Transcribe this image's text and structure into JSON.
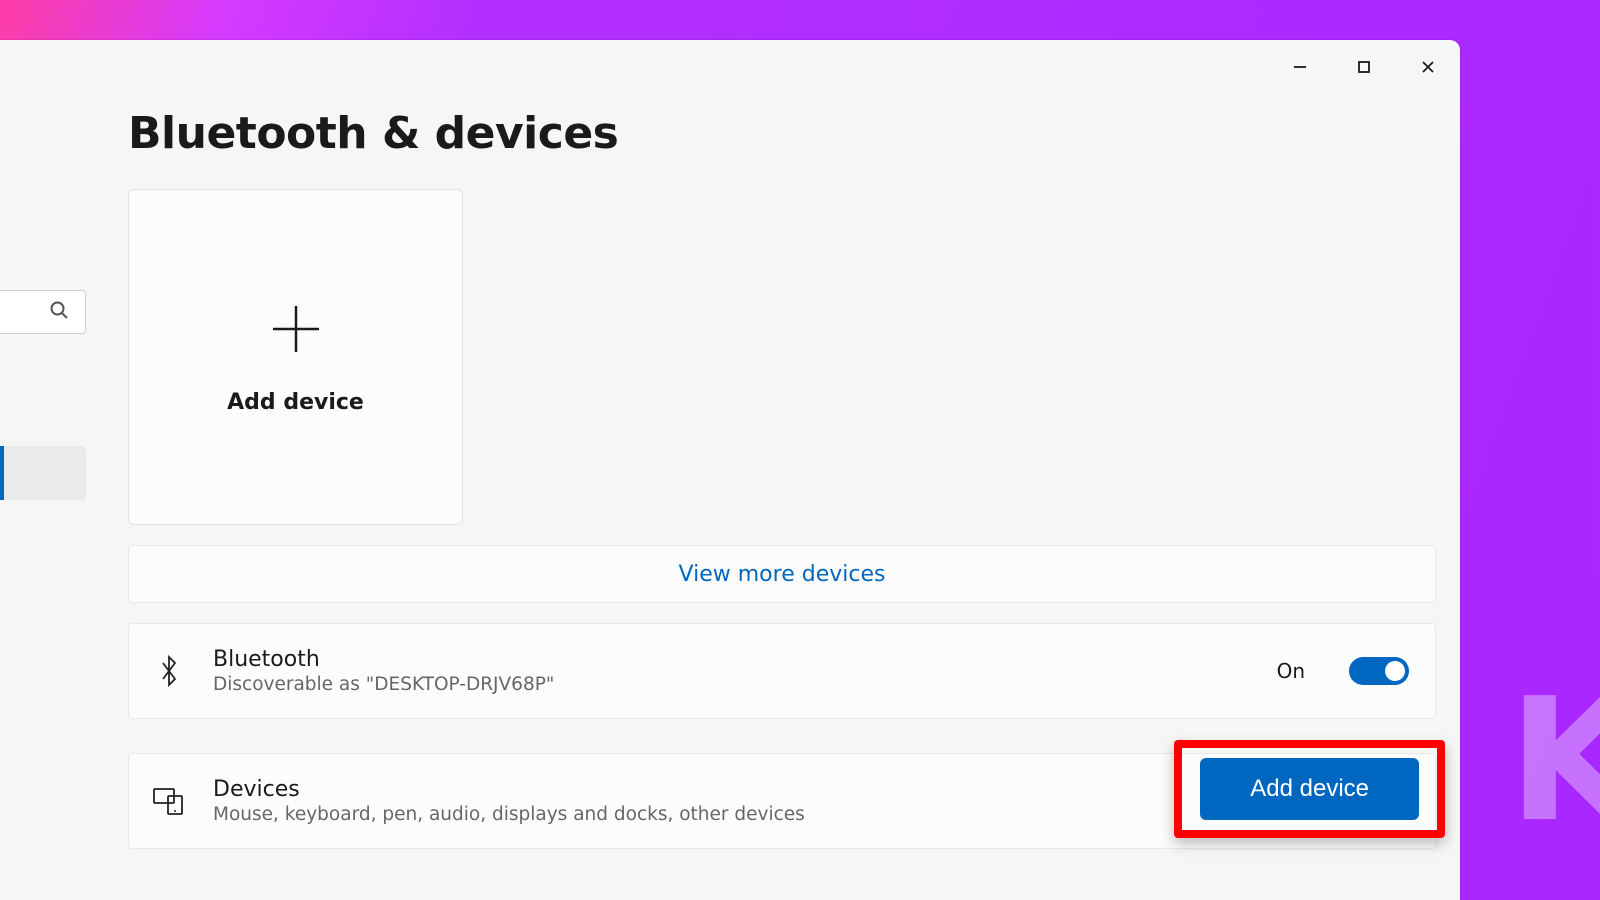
{
  "header": {
    "title": "Bluetooth & devices"
  },
  "add_device_card": {
    "label": "Add device"
  },
  "view_more": {
    "label": "View more devices"
  },
  "bluetooth_row": {
    "title": "Bluetooth",
    "subtitle": "Discoverable as \"DESKTOP-DRJV68P\"",
    "status_label": "On",
    "toggle_on": true
  },
  "devices_row": {
    "title": "Devices",
    "subtitle": "Mouse, keyboard, pen, audio, displays and docks, other devices",
    "button_label": "Add device"
  }
}
